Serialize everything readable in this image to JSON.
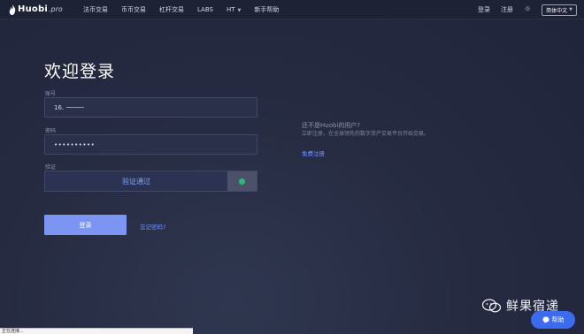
{
  "header": {
    "logo_text": "Huobi",
    "logo_suffix": ".pro",
    "nav": [
      {
        "label": "法币交易"
      },
      {
        "label": "币币交易"
      },
      {
        "label": "杠杆交易"
      },
      {
        "label": "LABS"
      },
      {
        "label": "HT"
      },
      {
        "label": "新手帮助"
      }
    ],
    "login_label": "登录",
    "register_label": "注册",
    "language_label": "简体中文"
  },
  "form": {
    "title": "欢迎登录",
    "account_label": "账号",
    "account_value": "16.",
    "password_label": "密码",
    "password_value": "••••••••••",
    "captcha_label": "验证",
    "captcha_status": "验证通过",
    "login_button": "登录",
    "forgot_link": "忘记密码?"
  },
  "promo": {
    "question": "还不是Huobi的用户?",
    "description": "立即注册，在全球领先的数字资产交易平台开始交易。",
    "register_link": "免费注册"
  },
  "watermark": {
    "text": "鲜果宿递"
  },
  "help_button": {
    "label": "帮助"
  },
  "status_bar": {
    "text": "正在连接..."
  },
  "colors": {
    "accent": "#7d95f2",
    "link": "#6f95ff",
    "background": "#262b41",
    "success": "#36b37e"
  }
}
